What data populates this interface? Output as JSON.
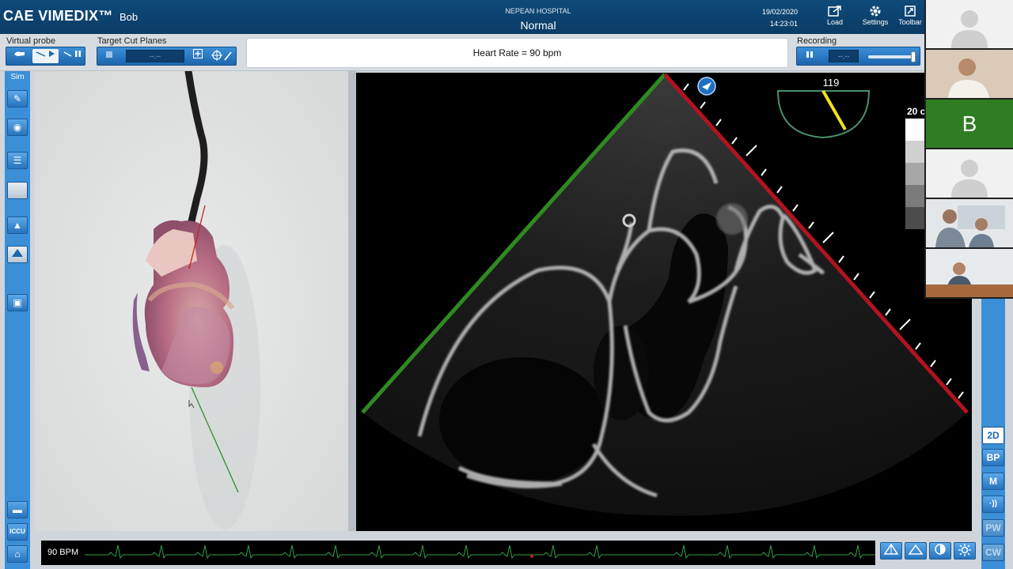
{
  "app": {
    "brand": "CAE VIMEDIX™",
    "user": "Bob",
    "hospital": "NEPEAN HOSPITAL",
    "mode": "Normal",
    "date": "19/02/2020",
    "time": "14:23:01"
  },
  "toolbar": {
    "load_label": "Load",
    "settings_label": "Settings",
    "toolbar_label": "Toolbar"
  },
  "controls": {
    "virtual_probe_label": "Virtual probe",
    "target_cut_planes_label": "Target Cut Planes",
    "target_value": "--.--",
    "recording_label": "Recording",
    "recording_value": "--.--",
    "heart_rate_text": "Heart Rate = 90 bpm",
    "recording_slider_percent": 95
  },
  "sidebar": {
    "sim_label": "Sim",
    "iccu_label": "ICCU"
  },
  "echo": {
    "angle": "119",
    "depth": "20 c"
  },
  "modes": {
    "items": [
      "2D",
      "BP",
      "M",
      "·))",
      "PW",
      "CW"
    ],
    "active": "2D"
  },
  "ecg": {
    "bpm_label": "90 BPM"
  },
  "call": {
    "participant_letter": "B"
  },
  "colors": {
    "brand_blue": "#0a3c66",
    "accent_blue": "#3a8fd6",
    "green_edge": "#2e8b1f",
    "red_edge": "#b0141e",
    "angle_needle": "#f2e21b"
  }
}
